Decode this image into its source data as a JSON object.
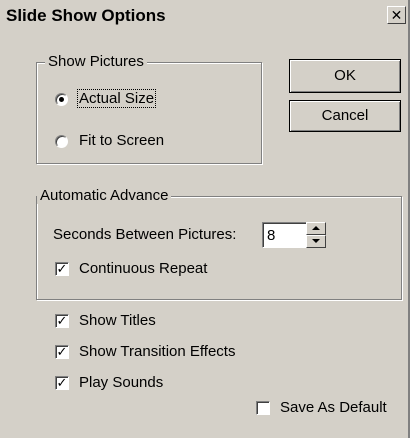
{
  "dialog": {
    "title": "Slide Show Options",
    "close_glyph": "✕"
  },
  "show_pictures": {
    "label": "Show Pictures",
    "options": [
      {
        "label": "Actual Size",
        "selected": true
      },
      {
        "label": "Fit to Screen",
        "selected": false
      }
    ]
  },
  "buttons": {
    "ok": "OK",
    "cancel": "Cancel"
  },
  "automatic_advance": {
    "label": "Automatic Advance",
    "seconds_label": "Seconds Between Pictures:",
    "seconds_value": "8",
    "continuous_repeat": {
      "label": "Continuous Repeat",
      "checked": true
    }
  },
  "options": {
    "show_titles": {
      "label": "Show Titles",
      "checked": true
    },
    "show_transition_effects": {
      "label": "Show Transition Effects",
      "checked": true
    },
    "play_sounds": {
      "label": "Play Sounds",
      "checked": true
    },
    "save_as_default": {
      "label": "Save As Default",
      "checked": false
    }
  },
  "check_glyph": "✓"
}
